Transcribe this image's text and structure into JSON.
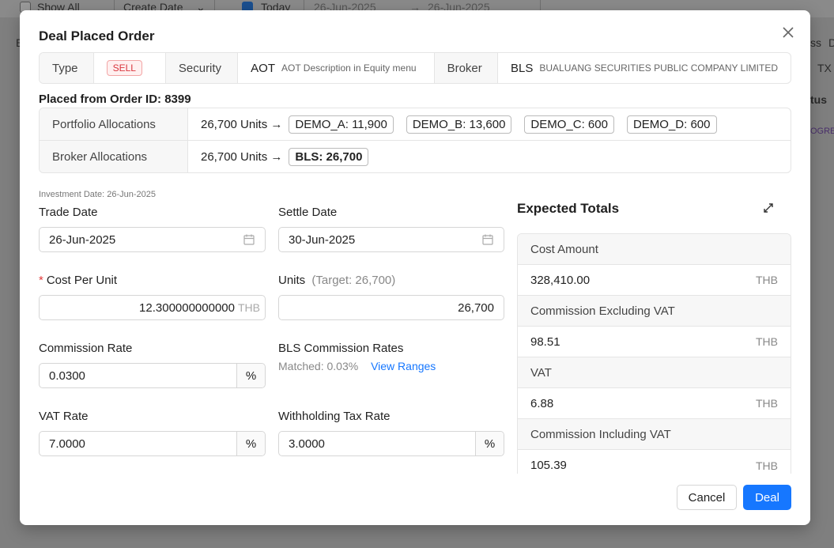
{
  "background": {
    "toolbar": {
      "show_all_label": "Show All",
      "create_date_label": "Create Date",
      "today_label": "Today",
      "date_from": "26-Jun-2025",
      "date_arrow": "→",
      "date_to": "26-Jun-2025"
    },
    "side_texts": [
      "E",
      "ss",
      "D",
      "TX",
      "tus",
      "OGRES"
    ]
  },
  "modal": {
    "title": "Deal Placed Order",
    "info": {
      "type_label": "Type",
      "type_value": "SELL",
      "security_label": "Security",
      "security_code": "AOT",
      "security_desc": "AOT Description in Equity menu",
      "broker_label": "Broker",
      "broker_code": "BLS",
      "broker_desc": "BUALUANG SECURITIES PUBLIC COMPANY LIMITED"
    },
    "placed_from": "Placed from Order ID: 8399",
    "allocations": {
      "portfolio_label": "Portfolio Allocations",
      "portfolio_units": "26,700 Units →",
      "portfolio_tags": [
        "DEMO_A: 11,900",
        "DEMO_B: 13,600",
        "DEMO_C: 600",
        "DEMO_D: 600"
      ],
      "broker_label": "Broker Allocations",
      "broker_units": "26,700 Units →",
      "broker_tags": [
        "BLS: 26,700"
      ]
    },
    "investment_date": "Investment Date: 26-Jun-2025",
    "form": {
      "trade_date_label": "Trade Date",
      "trade_date_value": "26-Jun-2025",
      "settle_date_label": "Settle Date",
      "settle_date_value": "30-Jun-2025",
      "cost_label_req": "*",
      "cost_label": "Cost Per Unit",
      "cost_value": "12.300000000000",
      "cost_unit": "THB",
      "units_label": "Units",
      "units_target": "(Target: 26,700)",
      "units_value": "26,700",
      "commission_rate_label": "Commission Rate",
      "commission_rate_value": "0.0300",
      "commission_rate_suffix": "%",
      "bls_rates_label": "BLS Commission Rates",
      "bls_matched": "Matched: 0.03%",
      "bls_view_ranges": "View Ranges",
      "vat_rate_label": "VAT Rate",
      "vat_rate_value": "7.0000",
      "vat_rate_suffix": "%",
      "wht_rate_label": "Withholding Tax Rate",
      "wht_rate_value": "3.0000",
      "wht_rate_suffix": "%"
    },
    "totals": {
      "title": "Expected Totals",
      "rows": [
        {
          "label": "Cost Amount",
          "value": "328,410.00",
          "unit": "THB"
        },
        {
          "label": "Commission Excluding VAT",
          "value": "98.51",
          "unit": "THB"
        },
        {
          "label": "VAT",
          "value": "6.88",
          "unit": "THB"
        },
        {
          "label": "Commission Including VAT",
          "value": "105.39",
          "unit": "THB"
        }
      ]
    },
    "buttons": {
      "cancel": "Cancel",
      "deal": "Deal"
    }
  },
  "icons": {
    "close": "close-icon",
    "calendar": "calendar-icon",
    "expand": "expand-icon"
  },
  "colors": {
    "primary": "#1677ff",
    "sell": "#d9363e",
    "required": "#e23b3b"
  }
}
